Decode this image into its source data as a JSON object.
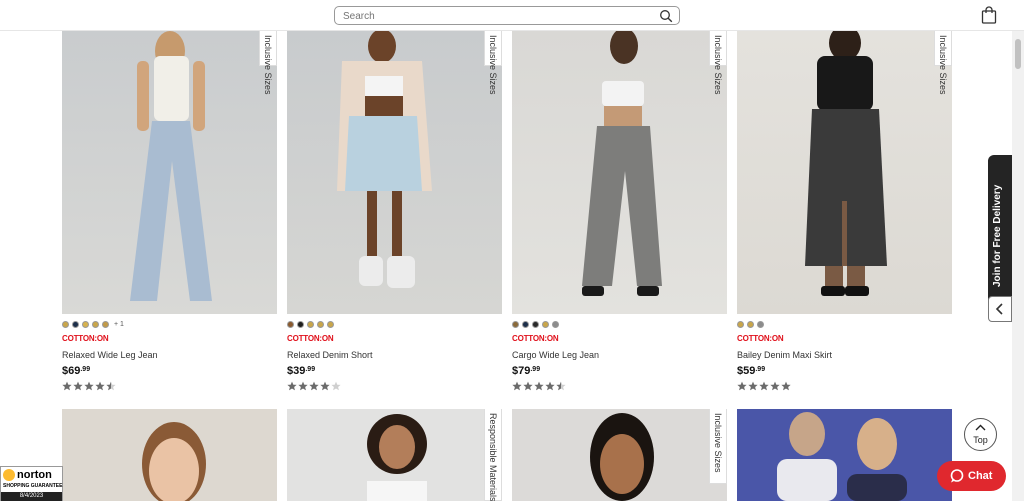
{
  "header": {
    "search_placeholder": "Search",
    "icons": [
      "search-icon",
      "shopping-bag-icon"
    ]
  },
  "products_row1": [
    {
      "badge": "Inclusive Sizes",
      "swatches": [
        "#c9a64a",
        "#1d2f4a",
        "#d6b24e",
        "#c9a64a",
        "#c19a48"
      ],
      "more": "+ 1",
      "brand": "COTTON:ON",
      "name": "Relaxed Wide Leg Jean",
      "price_main": "$69",
      "price_cents": ".99",
      "rating": 4.5
    },
    {
      "badge": "Inclusive Sizes",
      "swatches": [
        "#8a5a2e",
        "#1e1e1e",
        "#c9a64a",
        "#c9a64a",
        "#c9a64a"
      ],
      "more": "",
      "brand": "COTTON:ON",
      "name": "Relaxed Denim Short",
      "price_main": "$39",
      "price_cents": ".99",
      "rating": 4
    },
    {
      "badge": "Inclusive Sizes",
      "swatches": [
        "#8a6a3a",
        "#1d2f4a",
        "#2a2a2a",
        "#c9a64a",
        "#8c8c8c"
      ],
      "more": "",
      "brand": "COTTON:ON",
      "name": "Cargo Wide Leg Jean",
      "price_main": "$79",
      "price_cents": ".99",
      "rating": 4.5
    },
    {
      "badge": "Inclusive Sizes",
      "swatches": [
        "#c9a64a",
        "#c9a64a",
        "#8c8c8c"
      ],
      "more": "",
      "brand": "COTTON:ON",
      "name": "Bailey Denim Maxi Skirt",
      "price_main": "$59",
      "price_cents": ".99",
      "rating": 5
    }
  ],
  "products_row2": [
    {
      "badge": ""
    },
    {
      "badge": "Responsible Materials"
    },
    {
      "badge": "Inclusive Sizes"
    },
    {
      "badge": ""
    }
  ],
  "join_bar": {
    "label": "Join for Free Delivery"
  },
  "top_button": {
    "label": "Top"
  },
  "chat_button": {
    "label": "Chat"
  },
  "norton": {
    "name": "norton",
    "guarantee": "SHOPPING GUARANTEE",
    "date": "8/4/2023"
  },
  "colors": {
    "brand_red": "#e0101b",
    "chat_red": "#e0282e",
    "join_bar_bg": "#242424"
  }
}
